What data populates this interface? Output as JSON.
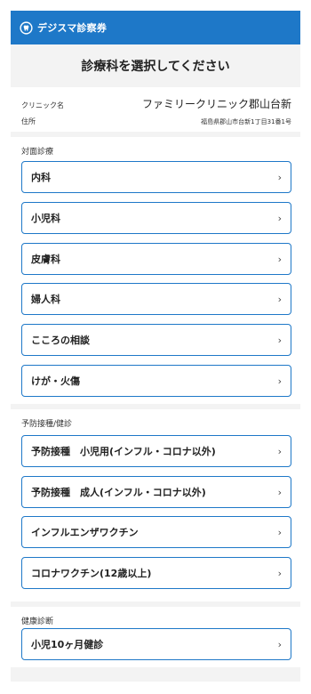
{
  "header": {
    "app_name": "デジスマ診察券",
    "logo_icon": "tooth-circle-icon",
    "color": "#1e78c8"
  },
  "page": {
    "title": "診療科を選択してください"
  },
  "clinic": {
    "name_label": "クリニック名",
    "name": "ファミリークリニック郡山台新",
    "address_label": "住所",
    "address": "福島県郡山市台新1丁目31番1号"
  },
  "sections": [
    {
      "title": "対面診療",
      "items": [
        "内科",
        "小児科",
        "皮膚科",
        "婦人科",
        "こころの相談",
        "けが・火傷"
      ]
    },
    {
      "title": "予防接種/健診",
      "items": [
        "予防接種　小児用(インフル・コロナ以外)",
        "予防接種　成人(インフル・コロナ以外)",
        "インフルエンザワクチン",
        "コロナワクチン(12歳以上)"
      ]
    },
    {
      "title": "健康診断",
      "items": [
        "小児10ヶ月健診"
      ]
    }
  ],
  "chevron_icon": "chevron-right-icon"
}
